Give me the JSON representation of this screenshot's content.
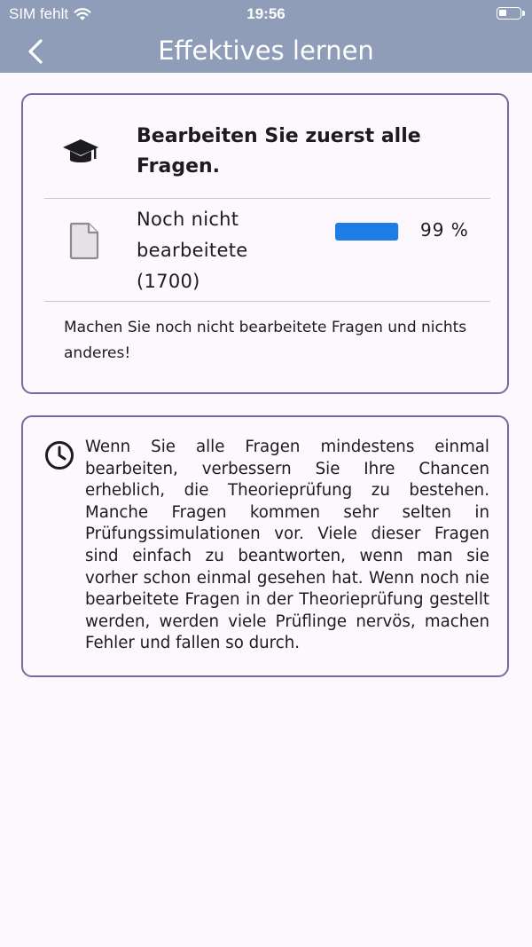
{
  "status_bar": {
    "carrier": "SIM fehlt",
    "time": "19:56"
  },
  "app_bar": {
    "title": "Effektives lernen"
  },
  "card_main": {
    "heading": "Bearbeiten Sie zuerst alle Fragen.",
    "heading_line1": "Bearbeiten Sie zuerst alle",
    "heading_line2": "Fragen.",
    "row_label_line1": "Noch nicht",
    "row_label_line2": "bearbeitete",
    "row_label_line3": "(1700)",
    "progress_value": 0.99,
    "progress_text": "99 %",
    "hint": "Machen Sie noch nicht bearbeitete Fragen und nichts anderes!"
  },
  "card_info": {
    "text": "Wenn Sie alle Fragen mindestens einmal bearbeiten, verbessern Sie Ihre Chancen erheblich, die Theorieprüfung zu bestehen. Manche Fragen kommen sehr selten in Prüfungssimulationen vor. Viele dieser Fragen sind einfach zu beantworten, wenn man sie vorher schon einmal gesehen hat. Wenn noch nie bearbeitete Fragen in der Theorieprüfung gestellt werden, werden viele Prüflinge nervös, machen Fehler und fallen so durch."
  },
  "icons": {
    "back": "chevron-left-icon",
    "wifi": "wifi-icon",
    "battery": "battery-icon",
    "graduation": "graduation-cap-icon",
    "document": "document-icon",
    "clock": "clock-icon"
  },
  "colors": {
    "app_bar": "#8f9db8",
    "card_border": "#7a6a9c",
    "progress": "#1e7ce6",
    "background": "#fdf8fd"
  }
}
